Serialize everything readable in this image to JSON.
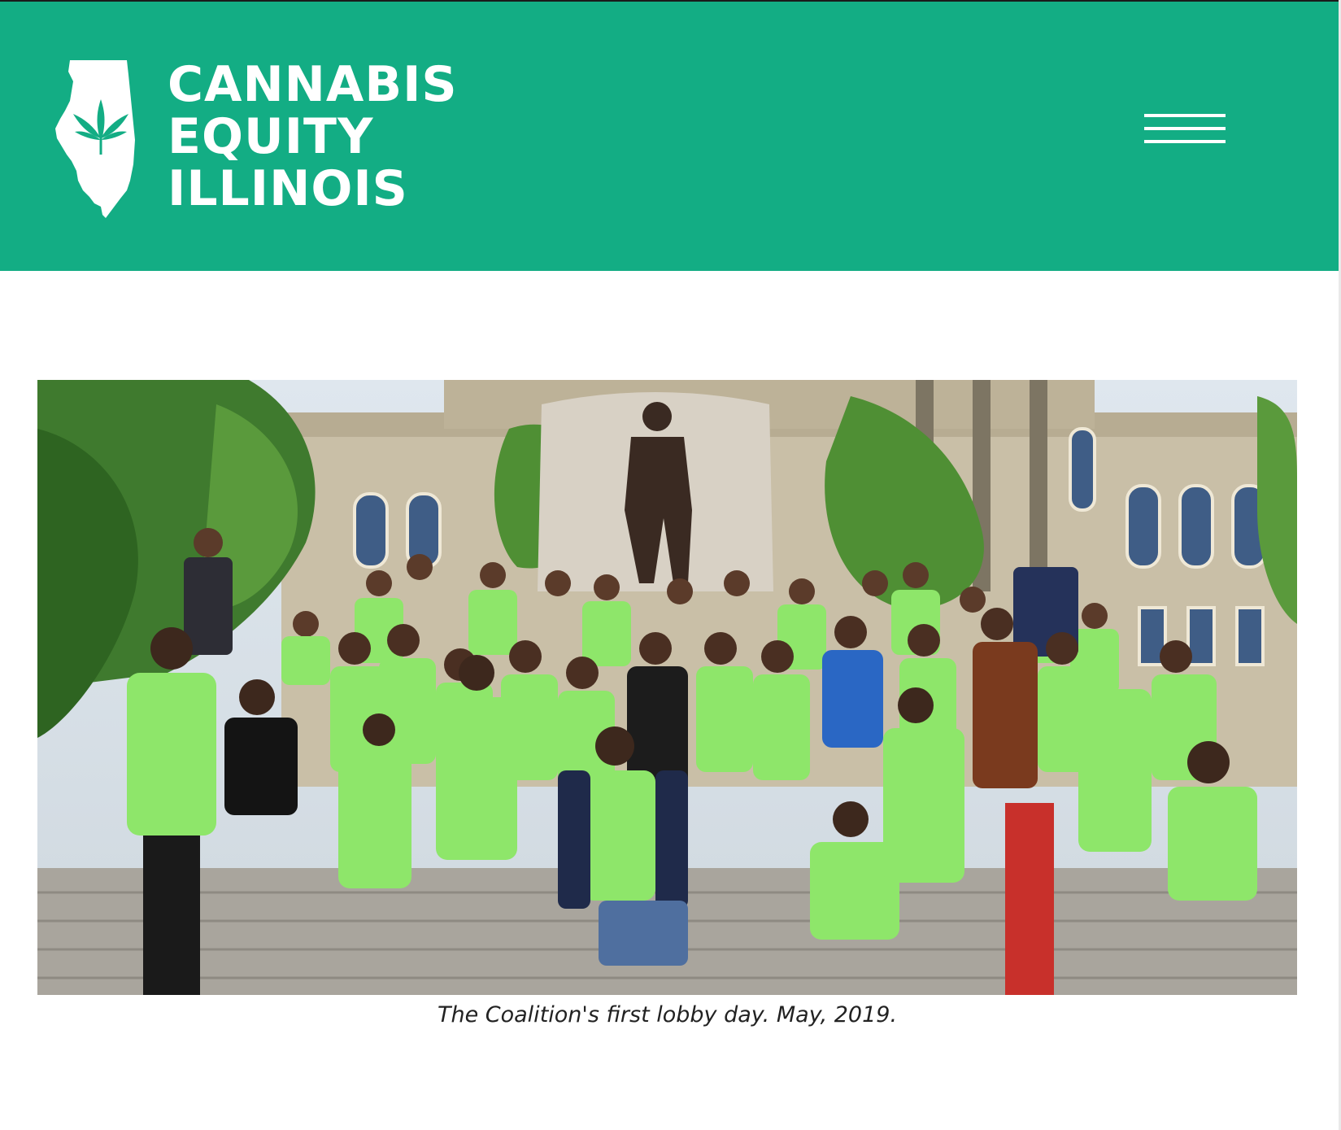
{
  "header": {
    "background_color": "#13ad84",
    "logo": {
      "line1": "CANNABIS",
      "line2": "EQUITY",
      "line3": "ILLINOIS",
      "icon": "illinois-map-cannabis-leaf-icon"
    },
    "menu": {
      "icon": "hamburger-menu-icon"
    }
  },
  "main": {
    "photo": {
      "subject": "group-photo"
    },
    "caption": "The Coalition's first lobby day. May, 2019."
  },
  "colors": {
    "brand_green": "#13ad84",
    "shirt_green": "#8ee66a",
    "text": "#222222"
  }
}
